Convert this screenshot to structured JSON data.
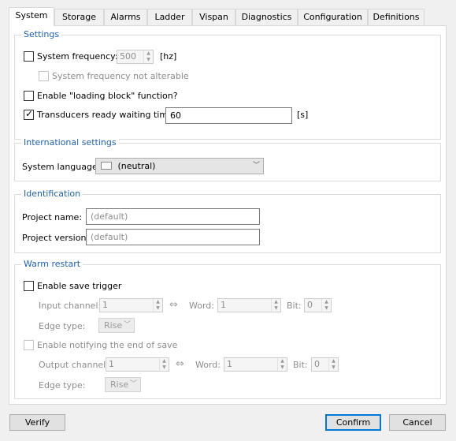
{
  "tabs": [
    {
      "label": "System",
      "active": true
    },
    {
      "label": "Storage"
    },
    {
      "label": "Alarms"
    },
    {
      "label": "Ladder"
    },
    {
      "label": "Vispan"
    },
    {
      "label": "Diagnostics"
    },
    {
      "label": "Configuration"
    },
    {
      "label": "Definitions"
    }
  ],
  "settings": {
    "title": "Settings",
    "sys_freq_label": "System frequency:",
    "sys_freq_value": "500",
    "sys_freq_unit": "[hz]",
    "sys_freq_not_alterable_label": "System frequency not alterable",
    "loading_block_label": "Enable \"loading block\" function?",
    "transducers_label": "Transducers ready waiting time:",
    "transducers_checked": true,
    "transducers_value": "60",
    "transducers_unit": "[s]"
  },
  "international": {
    "title": "International settings",
    "language_label": "System language:",
    "language_value": "(neutral)"
  },
  "identification": {
    "title": "Identification",
    "project_name_label": "Project name:",
    "project_name_placeholder": "(default)",
    "project_version_label": "Project version:",
    "project_version_placeholder": "(default)"
  },
  "warm_restart": {
    "title": "Warm restart",
    "enable_save_trigger_label": "Enable save trigger",
    "input_channel_label": "Input channel:",
    "input_channel_value": "1",
    "word_label": "Word:",
    "input_word_value": "1",
    "bit_label": "Bit:",
    "input_bit_value": "0",
    "edge_type_label": "Edge type:",
    "edge_type_value": "Rise",
    "enable_notify_label": "Enable notifying the end of save",
    "output_channel_label": "Output channel:",
    "output_channel_value": "1",
    "output_word_value": "1",
    "output_bit_value": "0",
    "output_edge_type_value": "Rise"
  },
  "footer": {
    "verify_label": "Verify",
    "confirm_label": "Confirm",
    "cancel_label": "Cancel"
  },
  "colors": {
    "legend": "#1f62b0",
    "accent": "#0078d7"
  },
  "icons": [
    "language-flag-icon",
    "link-arrows-icon",
    "chevron-down-icon",
    "spin-arrows-icon",
    "checkmark-icon"
  ]
}
